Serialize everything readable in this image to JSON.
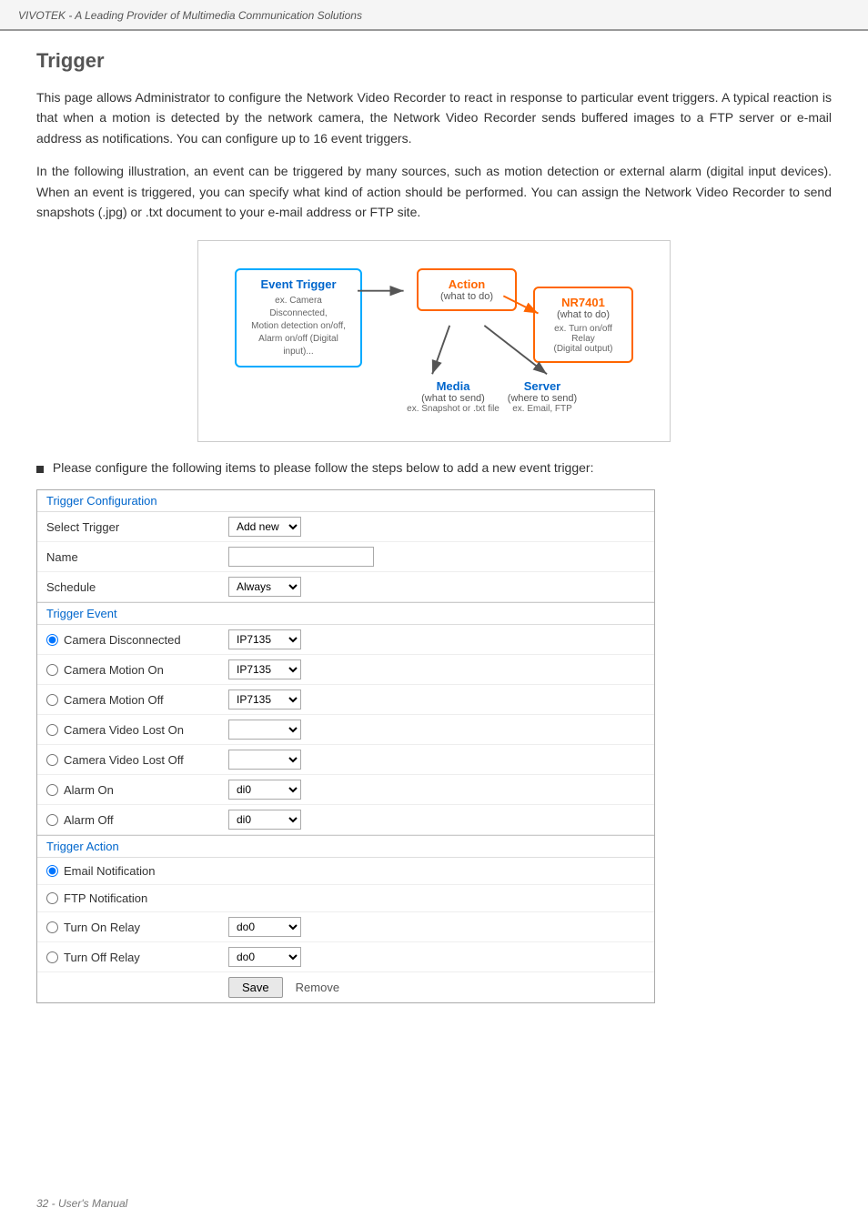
{
  "header": {
    "text": "VIVOTEK - A Leading Provider of Multimedia Communication Solutions"
  },
  "page": {
    "title": "Trigger",
    "description1": "This page allows Administrator to configure the Network Video Recorder to react in response to particular event triggers. A typical reaction is that when a motion is detected by the network camera, the Network Video Recorder sends buffered images to a FTP server or e-mail address as notifications. You can configure up to 16 event triggers.",
    "description2": "In the following illustration, an event can be triggered by many sources, such as motion detection or external alarm (digital input devices). When an event is triggered, you can specify what kind of action should be performed. You can assign the Network Video Recorder to send snapshots (.jpg) or .txt document to your e-mail address or FTP site.",
    "instruction": "Please configure the following items to please follow the steps below to add a new event trigger:"
  },
  "diagram": {
    "event_trigger_label": "Event Trigger",
    "event_trigger_ex": "ex. Camera Disconnected,\nMotion detection on/off,\nAlarm on/off (Digital input)...",
    "action_label": "Action",
    "action_sub": "(what to do)",
    "nr7401_label": "NR7401",
    "nr7401_sub": "(what to do)",
    "nr7401_ex": "ex. Turn on/off Relay\n(Digital output)",
    "media_label": "Media",
    "media_sub": "(what to send)",
    "media_ex": "ex. Snapshot or .txt file",
    "server_label": "Server",
    "server_sub": "(where to send)",
    "server_ex": "ex. Email, FTP"
  },
  "trigger_config": {
    "section_title": "Trigger Configuration",
    "select_trigger_label": "Select Trigger",
    "select_trigger_options": [
      "Add new"
    ],
    "select_trigger_value": "Add new",
    "name_label": "Name",
    "name_value": "",
    "schedule_label": "Schedule",
    "schedule_options": [
      "Always"
    ],
    "schedule_value": "Always"
  },
  "trigger_event": {
    "section_title": "Trigger Event",
    "camera_disconnected_label": "Camera Disconnected",
    "camera_disconnected_options": [
      "IP7135"
    ],
    "camera_disconnected_value": "IP7135",
    "camera_motion_on_label": "Camera Motion On",
    "camera_motion_on_options": [
      "IP7135"
    ],
    "camera_motion_on_value": "IP7135",
    "camera_motion_off_label": "Camera Motion Off",
    "camera_motion_off_options": [
      "IP7135"
    ],
    "camera_motion_off_value": "IP7135",
    "camera_video_lost_on_label": "Camera Video Lost On",
    "camera_video_lost_on_value": "",
    "camera_video_lost_off_label": "Camera Video Lost Off",
    "camera_video_lost_off_value": "",
    "alarm_on_label": "Alarm On",
    "alarm_on_options": [
      "di0"
    ],
    "alarm_on_value": "di0",
    "alarm_off_label": "Alarm Off",
    "alarm_off_options": [
      "di0"
    ],
    "alarm_off_value": "di0"
  },
  "trigger_action": {
    "section_title": "Trigger Action",
    "email_notification_label": "Email Notification",
    "ftp_notification_label": "FTP Notification",
    "turn_on_relay_label": "Turn On Relay",
    "turn_on_relay_options": [
      "do0"
    ],
    "turn_on_relay_value": "do0",
    "turn_off_relay_label": "Turn Off Relay",
    "turn_off_relay_options": [
      "do0"
    ],
    "turn_off_relay_value": "do0"
  },
  "buttons": {
    "save_label": "Save",
    "remove_label": "Remove"
  },
  "footer": {
    "text": "32 - User's Manual"
  }
}
